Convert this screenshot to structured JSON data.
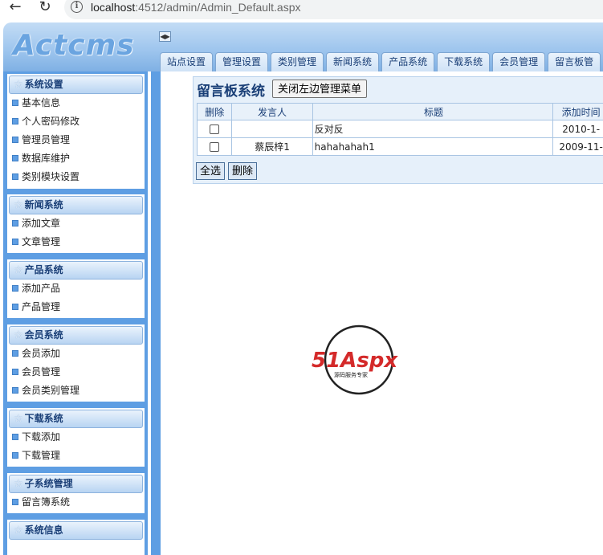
{
  "browser": {
    "url_host": "localhost",
    "url_rest": ":4512/admin/Admin_Default.aspx"
  },
  "header": {
    "logo": "Actcms",
    "tabs": [
      "站点设置",
      "管理设置",
      "类别管理",
      "新闻系统",
      "产品系统",
      "下载系统",
      "会员管理",
      "留言板管"
    ]
  },
  "sidebar": {
    "sections": [
      {
        "title": "系统设置",
        "items": [
          "基本信息",
          "个人密码修改",
          "管理员管理",
          "数据库维护",
          "类别模块设置"
        ]
      },
      {
        "title": "新闻系统",
        "items": [
          "添加文章",
          "文章管理"
        ]
      },
      {
        "title": "产品系统",
        "items": [
          "添加产品",
          "产品管理"
        ]
      },
      {
        "title": "会员系统",
        "items": [
          "会员添加",
          "会员管理",
          "会员类别管理"
        ]
      },
      {
        "title": "下载系统",
        "items": [
          "下载添加",
          "下载管理"
        ]
      },
      {
        "title": "子系统管理",
        "items": [
          "留言簿系统"
        ]
      },
      {
        "title": "系统信息",
        "items": []
      }
    ]
  },
  "main": {
    "title": "留言板系统",
    "close_menu_label": "关闭左边管理菜单",
    "table": {
      "headers": [
        "删除",
        "发言人",
        "标题",
        "添加时间"
      ],
      "rows": [
        {
          "user": "",
          "title": "反对反",
          "time": "2010-1-"
        },
        {
          "user": "蔡辰梓1",
          "title": "hahahahah1",
          "time": "2009-11-"
        }
      ]
    },
    "select_all_label": "全选",
    "delete_label": "删除"
  },
  "watermark": {
    "brand": "51Aspx",
    "tagline": "源码服务专家"
  }
}
